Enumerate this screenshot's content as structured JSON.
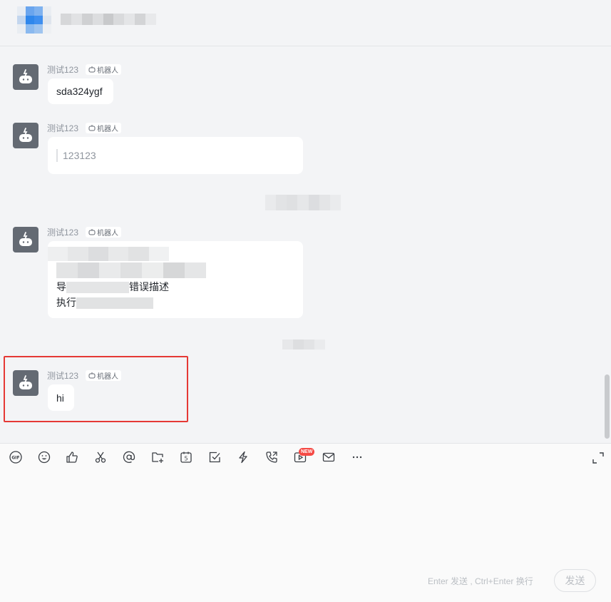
{
  "chat_header": {
    "title": "",
    "blurred": true
  },
  "messages": [
    {
      "sender": "测试123",
      "tag": "机器人",
      "text": "sda324ygf"
    },
    {
      "sender": "测试123",
      "tag": "机器人",
      "quote": "123123"
    },
    {
      "system_notice_blurred": true
    },
    {
      "sender": "测试123",
      "tag": "机器人",
      "blurred_lines": [
        "",
        "",
        "错误描述",
        ""
      ],
      "line_prefixes": [
        "导",
        "执行"
      ]
    },
    {
      "system_notice_blurred": true
    },
    {
      "sender": "测试123",
      "tag": "机器人",
      "text": "hi",
      "highlighted": true
    }
  ],
  "toolbar": {
    "icons": [
      "gif-icon",
      "emoji-icon",
      "thumbs-up-icon",
      "scissors-icon",
      "mention-icon",
      "folder-add-icon",
      "calendar-icon",
      "task-check-icon",
      "lightning-icon",
      "phone-call-icon",
      "video-meeting-icon",
      "mail-icon",
      "more-icon"
    ],
    "new_badge": "NEW",
    "expand_icon": "expand-icon"
  },
  "composer": {
    "hint": "Enter 发送 , Ctrl+Enter 换行",
    "send_label": "发送"
  },
  "colors": {
    "accent_highlight": "#e53935",
    "avatar_bg": "#646a73",
    "badge_red": "#f54a45"
  }
}
